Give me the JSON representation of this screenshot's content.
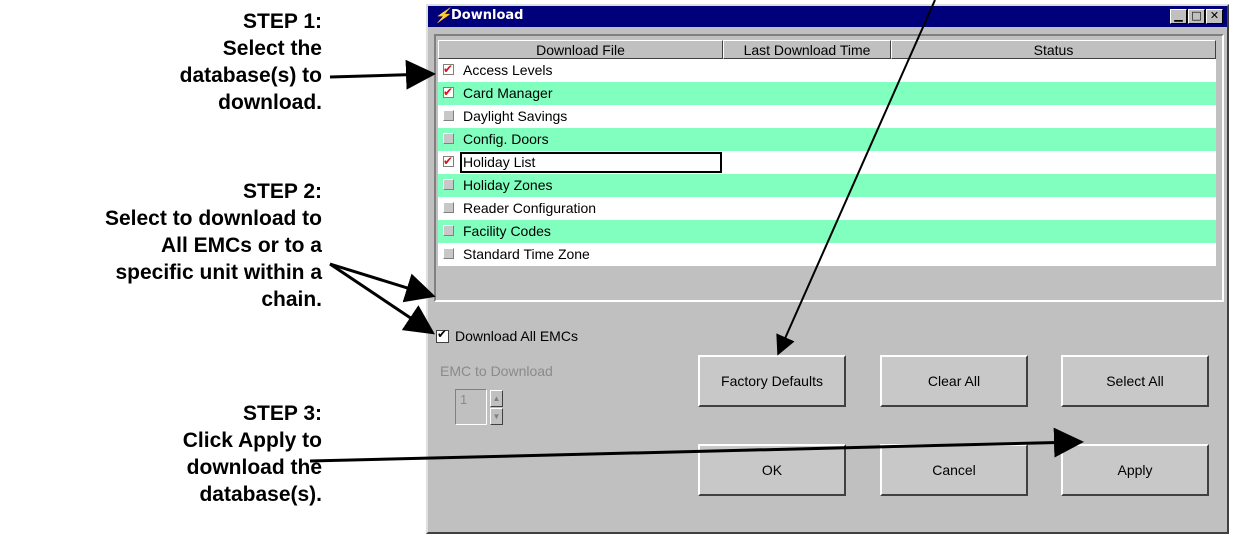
{
  "callouts": {
    "step1": {
      "lines": [
        "STEP 1:",
        "Select the",
        "database(s) to",
        "download."
      ]
    },
    "step2": {
      "lines": [
        "STEP 2:",
        "Select to download to",
        "All EMCs or to a",
        "specific unit within a",
        "chain."
      ]
    },
    "step3": {
      "lines": [
        "STEP 3:",
        "Click Apply to",
        "download the",
        "database(s)."
      ]
    }
  },
  "window": {
    "title": "Download",
    "title_icon": "lightning-icon",
    "controls": {
      "minimize": "▁",
      "maximize": "□",
      "close": "✕"
    }
  },
  "table": {
    "headers": [
      "Download File",
      "Last Download Time",
      "Status"
    ],
    "rows": [
      {
        "label": "Access Levels",
        "checked": true,
        "highlight": false
      },
      {
        "label": "Card Manager",
        "checked": true,
        "highlight": true
      },
      {
        "label": "Daylight Savings",
        "checked": false,
        "highlight": false
      },
      {
        "label": "Config. Doors",
        "checked": false,
        "highlight": true
      },
      {
        "label": "Holiday List",
        "checked": true,
        "highlight": false,
        "focused": true
      },
      {
        "label": "Holiday Zones",
        "checked": false,
        "highlight": true
      },
      {
        "label": "Reader Configuration",
        "checked": false,
        "highlight": false
      },
      {
        "label": "Facility Codes",
        "checked": false,
        "highlight": true
      },
      {
        "label": "Standard Time Zone",
        "checked": false,
        "highlight": false
      }
    ]
  },
  "options": {
    "download_all_label": "Download All EMCs",
    "download_all_checked": true,
    "emc_label": "EMC to Download",
    "emc_value": "1"
  },
  "buttons": {
    "factory_defaults": "Factory Defaults",
    "clear_all": "Clear All",
    "select_all": "Select All",
    "ok": "OK",
    "cancel": "Cancel",
    "apply": "Apply"
  },
  "colors": {
    "titlebar": "#00007b",
    "row_highlight": "#80ffbe",
    "check_mark": "#e01010",
    "window_face": "#c0c0c0"
  }
}
